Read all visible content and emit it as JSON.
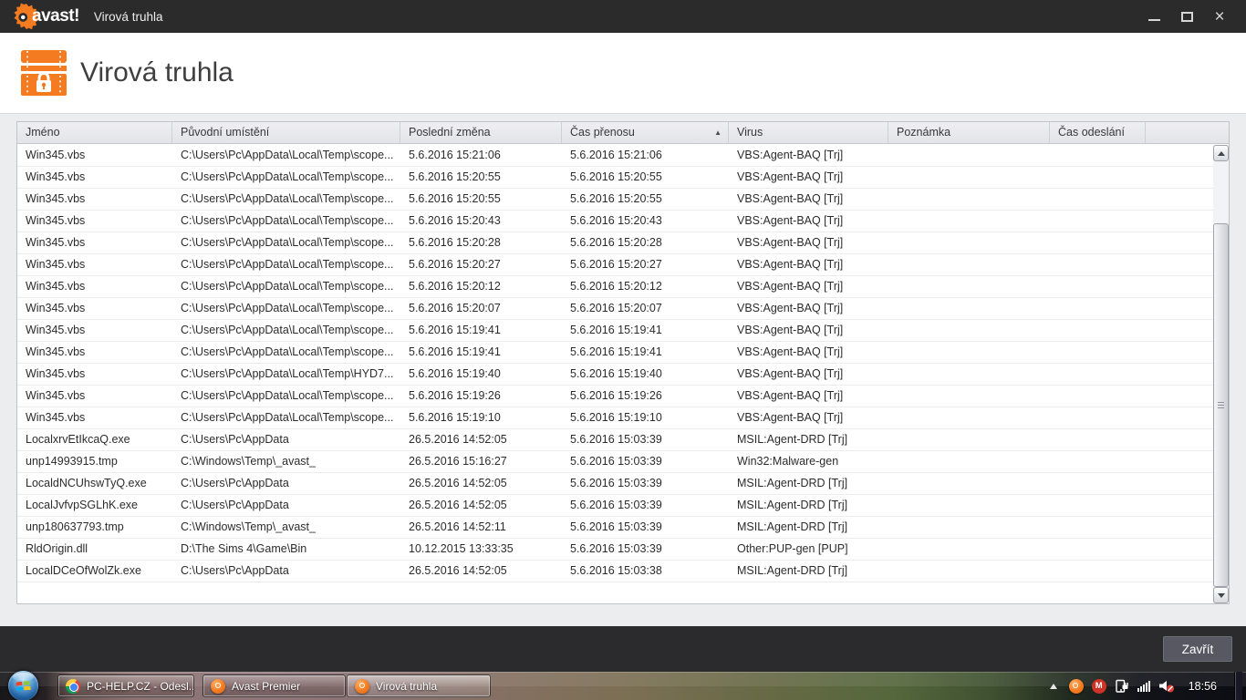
{
  "titlebar": {
    "brand": "avast!",
    "window_title": "Virová truhla",
    "close_glyph": "×"
  },
  "header": {
    "title": "Virová truhla"
  },
  "table": {
    "columns": [
      "Jméno",
      "Původní umístění",
      "Poslední změna",
      "Čas přenosu",
      "Virus",
      "Poznámka",
      "Čas odeslání"
    ],
    "sort": {
      "column": "Čas přenosu",
      "direction": "asc"
    },
    "rows": [
      {
        "name": "Win345.vbs",
        "location": "C:\\Users\\Pc\\AppData\\Local\\Temp\\scope...",
        "modified": "5.6.2016 15:21:06",
        "transferred": "5.6.2016 15:21:06",
        "virus": "VBS:Agent-BAQ [Trj]",
        "note": "",
        "sent": ""
      },
      {
        "name": "Win345.vbs",
        "location": "C:\\Users\\Pc\\AppData\\Local\\Temp\\scope...",
        "modified": "5.6.2016 15:20:55",
        "transferred": "5.6.2016 15:20:55",
        "virus": "VBS:Agent-BAQ [Trj]",
        "note": "",
        "sent": ""
      },
      {
        "name": "Win345.vbs",
        "location": "C:\\Users\\Pc\\AppData\\Local\\Temp\\scope...",
        "modified": "5.6.2016 15:20:55",
        "transferred": "5.6.2016 15:20:55",
        "virus": "VBS:Agent-BAQ [Trj]",
        "note": "",
        "sent": ""
      },
      {
        "name": "Win345.vbs",
        "location": "C:\\Users\\Pc\\AppData\\Local\\Temp\\scope...",
        "modified": "5.6.2016 15:20:43",
        "transferred": "5.6.2016 15:20:43",
        "virus": "VBS:Agent-BAQ [Trj]",
        "note": "",
        "sent": ""
      },
      {
        "name": "Win345.vbs",
        "location": "C:\\Users\\Pc\\AppData\\Local\\Temp\\scope...",
        "modified": "5.6.2016 15:20:28",
        "transferred": "5.6.2016 15:20:28",
        "virus": "VBS:Agent-BAQ [Trj]",
        "note": "",
        "sent": ""
      },
      {
        "name": "Win345.vbs",
        "location": "C:\\Users\\Pc\\AppData\\Local\\Temp\\scope...",
        "modified": "5.6.2016 15:20:27",
        "transferred": "5.6.2016 15:20:27",
        "virus": "VBS:Agent-BAQ [Trj]",
        "note": "",
        "sent": ""
      },
      {
        "name": "Win345.vbs",
        "location": "C:\\Users\\Pc\\AppData\\Local\\Temp\\scope...",
        "modified": "5.6.2016 15:20:12",
        "transferred": "5.6.2016 15:20:12",
        "virus": "VBS:Agent-BAQ [Trj]",
        "note": "",
        "sent": ""
      },
      {
        "name": "Win345.vbs",
        "location": "C:\\Users\\Pc\\AppData\\Local\\Temp\\scope...",
        "modified": "5.6.2016 15:20:07",
        "transferred": "5.6.2016 15:20:07",
        "virus": "VBS:Agent-BAQ [Trj]",
        "note": "",
        "sent": ""
      },
      {
        "name": "Win345.vbs",
        "location": "C:\\Users\\Pc\\AppData\\Local\\Temp\\scope...",
        "modified": "5.6.2016 15:19:41",
        "transferred": "5.6.2016 15:19:41",
        "virus": "VBS:Agent-BAQ [Trj]",
        "note": "",
        "sent": ""
      },
      {
        "name": "Win345.vbs",
        "location": "C:\\Users\\Pc\\AppData\\Local\\Temp\\scope...",
        "modified": "5.6.2016 15:19:41",
        "transferred": "5.6.2016 15:19:41",
        "virus": "VBS:Agent-BAQ [Trj]",
        "note": "",
        "sent": ""
      },
      {
        "name": "Win345.vbs",
        "location": "C:\\Users\\Pc\\AppData\\Local\\Temp\\HYD7...",
        "modified": "5.6.2016 15:19:40",
        "transferred": "5.6.2016 15:19:40",
        "virus": "VBS:Agent-BAQ [Trj]",
        "note": "",
        "sent": ""
      },
      {
        "name": "Win345.vbs",
        "location": "C:\\Users\\Pc\\AppData\\Local\\Temp\\scope...",
        "modified": "5.6.2016 15:19:26",
        "transferred": "5.6.2016 15:19:26",
        "virus": "VBS:Agent-BAQ [Trj]",
        "note": "",
        "sent": ""
      },
      {
        "name": "Win345.vbs",
        "location": "C:\\Users\\Pc\\AppData\\Local\\Temp\\scope...",
        "modified": "5.6.2016 15:19:10",
        "transferred": "5.6.2016 15:19:10",
        "virus": "VBS:Agent-BAQ [Trj]",
        "note": "",
        "sent": ""
      },
      {
        "name": "LocalxrvEtIkcaQ.exe",
        "location": "C:\\Users\\Pc\\AppData",
        "modified": "26.5.2016 14:52:05",
        "transferred": "5.6.2016 15:03:39",
        "virus": "MSIL:Agent-DRD [Trj]",
        "note": "",
        "sent": ""
      },
      {
        "name": "unp14993915.tmp",
        "location": "C:\\Windows\\Temp\\_avast_",
        "modified": "26.5.2016 15:16:27",
        "transferred": "5.6.2016 15:03:39",
        "virus": "Win32:Malware-gen",
        "note": "",
        "sent": ""
      },
      {
        "name": "LocaldNCUhswTyQ.exe",
        "location": "C:\\Users\\Pc\\AppData",
        "modified": "26.5.2016 14:52:05",
        "transferred": "5.6.2016 15:03:39",
        "virus": "MSIL:Agent-DRD [Trj]",
        "note": "",
        "sent": ""
      },
      {
        "name": "LocalJvfvpSGLhK.exe",
        "location": "C:\\Users\\Pc\\AppData",
        "modified": "26.5.2016 14:52:05",
        "transferred": "5.6.2016 15:03:39",
        "virus": "MSIL:Agent-DRD [Trj]",
        "note": "",
        "sent": ""
      },
      {
        "name": "unp180637793.tmp",
        "location": "C:\\Windows\\Temp\\_avast_",
        "modified": "26.5.2016 14:52:11",
        "transferred": "5.6.2016 15:03:39",
        "virus": "MSIL:Agent-DRD [Trj]",
        "note": "",
        "sent": ""
      },
      {
        "name": "RldOrigin.dll",
        "location": "D:\\The Sims 4\\Game\\Bin",
        "modified": "10.12.2015 13:33:35",
        "transferred": "5.6.2016 15:03:39",
        "virus": "Other:PUP-gen [PUP]",
        "note": "",
        "sent": ""
      },
      {
        "name": "LocalDCeOfWolZk.exe",
        "location": "C:\\Users\\Pc\\AppData",
        "modified": "26.5.2016 14:52:05",
        "transferred": "5.6.2016 15:03:38",
        "virus": "MSIL:Agent-DRD [Trj]",
        "note": "",
        "sent": ""
      }
    ]
  },
  "footer": {
    "close_button": "Zavřít"
  },
  "taskbar": {
    "buttons": [
      {
        "label": "PC-HELP.CZ - Odesl...",
        "icon": "chrome-icon",
        "active": false
      },
      {
        "label": "Avast Premier",
        "icon": "avast-icon",
        "active": false
      },
      {
        "label": "Virová truhla",
        "icon": "avast-icon",
        "active": true
      }
    ],
    "tray": {
      "icons": [
        "show-hidden-icons",
        "avast-tray-icon",
        "mail-notifier-icon",
        "power-plug-icon",
        "network-signal-icon",
        "volume-muted-icon"
      ],
      "clock": "18:56"
    }
  },
  "colors": {
    "avast_orange": "#f47b20",
    "titlebar_bg": "#2b2b2b",
    "footer_bg": "#2b2b2d",
    "taskbar_active_tint": "#ffffff"
  }
}
